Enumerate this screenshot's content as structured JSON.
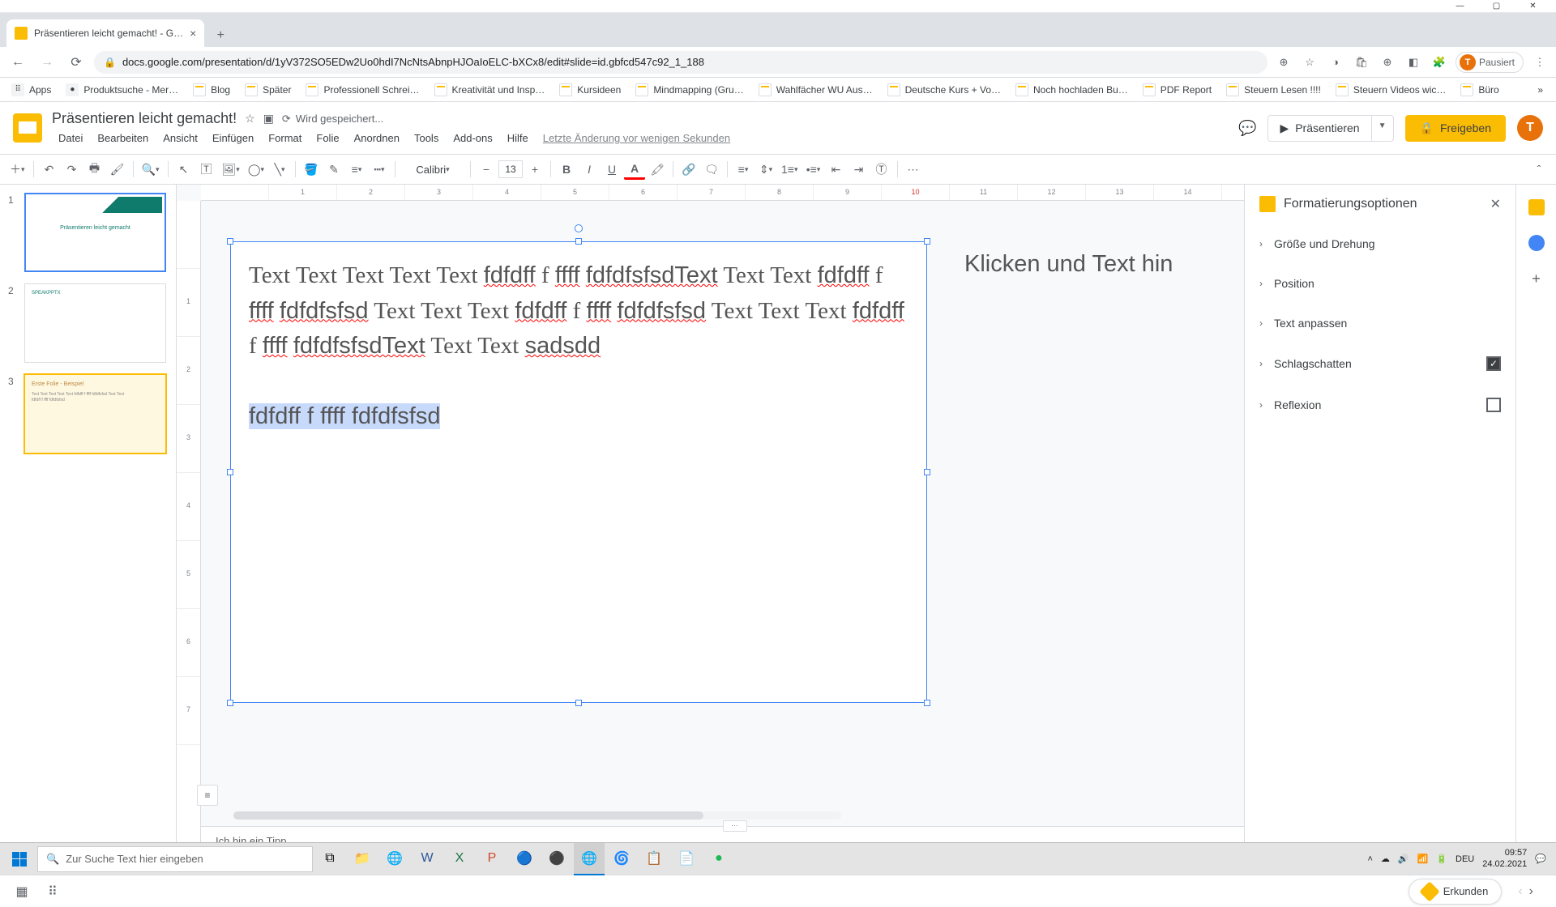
{
  "browser": {
    "tab_title": "Präsentieren leicht gemacht! - G…",
    "url": "docs.google.com/presentation/d/1yV372SO5EDw2Uo0hdI7NcNtsAbnpHJOaIoELC-bXCx8/edit#slide=id.gbfcd547c92_1_188",
    "profile_state": "Pausiert",
    "profile_initial": "T"
  },
  "bookmarks": [
    "Apps",
    "Produktsuche - Mer…",
    "Blog",
    "Später",
    "Professionell Schrei…",
    "Kreativität und Insp…",
    "Kursideen",
    "Mindmapping  (Gru…",
    "Wahlfächer WU Aus…",
    "Deutsche Kurs + Vo…",
    "Noch hochladen Bu…",
    "PDF Report",
    "Steuern Lesen !!!!",
    "Steuern Videos wic…",
    "Büro"
  ],
  "doc": {
    "title": "Präsentieren leicht gemacht!",
    "saving": "Wird gespeichert...",
    "last_edit": "Letzte Änderung vor wenigen Sekunden"
  },
  "menus": [
    "Datei",
    "Bearbeiten",
    "Ansicht",
    "Einfügen",
    "Format",
    "Folie",
    "Anordnen",
    "Tools",
    "Add-ons",
    "Hilfe"
  ],
  "header_buttons": {
    "present": "Präsentieren",
    "share": "Freigeben"
  },
  "toolbar": {
    "font": "Calibri",
    "size": "13"
  },
  "slide_text": {
    "p1": "Text Text Text Text Text fdfdff f ffff fdfdfsfsdText Text Text fdfdff f ffff fdfdfsfsd Text Text Text fdfdff f ffff fdfdfsfsd Text Text Text fdfdff f ffff fdfdfsfsdText Text Text sadsdd",
    "p2": "fdfdff f ffff fdfdfsfsd",
    "hint": "Klicken und Text hin"
  },
  "notes": "Ich bin ein Tipp",
  "format_panel": {
    "title": "Formatierungsoptionen",
    "sections": [
      {
        "label": "Größe und Drehung",
        "check": null
      },
      {
        "label": "Position",
        "check": null
      },
      {
        "label": "Text anpassen",
        "check": null
      },
      {
        "label": "Schlagschatten",
        "check": true
      },
      {
        "label": "Reflexion",
        "check": false
      }
    ]
  },
  "explore": "Erkunden",
  "thumbnails": [
    {
      "title": "Präsentieren leicht gemacht"
    },
    {
      "title": "SPEAKPPTX"
    },
    {
      "title": "Erste Folie - Beispiel"
    }
  ],
  "taskbar": {
    "search_placeholder": "Zur Suche Text hier eingeben",
    "lang": "DEU",
    "time": "09:57",
    "date": "24.02.2021"
  }
}
